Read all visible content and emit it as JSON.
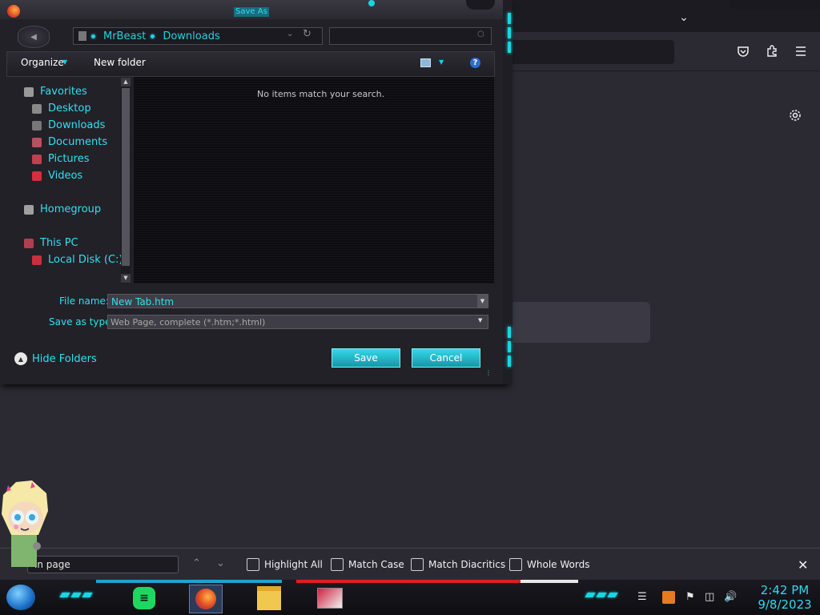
{
  "dialog": {
    "title": "Save As",
    "breadcrumb": [
      "MrBeast",
      "Downloads"
    ],
    "toolbar": {
      "organize": "Organize",
      "new_folder": "New folder",
      "help": "?"
    },
    "nav": {
      "favorites": "Favorites",
      "desktop": "Desktop",
      "downloads": "Downloads",
      "documents": "Documents",
      "pictures": "Pictures",
      "videos": "Videos",
      "homegroup": "Homegroup",
      "this_pc": "This PC",
      "local_disk": "Local Disk (C:)"
    },
    "empty_message": "No items match your search.",
    "file_name_label": "File name:",
    "file_name_value": "New Tab.htm",
    "save_type_label": "Save as type:",
    "save_type_value": "Web Page, complete (*.htm;*.html)",
    "hide_folders": "Hide Folders",
    "save_button": "Save",
    "cancel_button": "Cancel"
  },
  "findbar": {
    "input_value": "in page",
    "highlight_all": "Highlight All",
    "match_case": "Match Case",
    "match_diacritics": "Match Diacritics",
    "whole_words": "Whole Words"
  },
  "taskbar": {
    "time": "2:42 PM",
    "date": "9/8/2023"
  },
  "icons": {
    "accent": "#2fe0f0",
    "firefox": "firefox-icon",
    "spotify": "spotify-icon",
    "explorer": "file-explorer-icon"
  }
}
